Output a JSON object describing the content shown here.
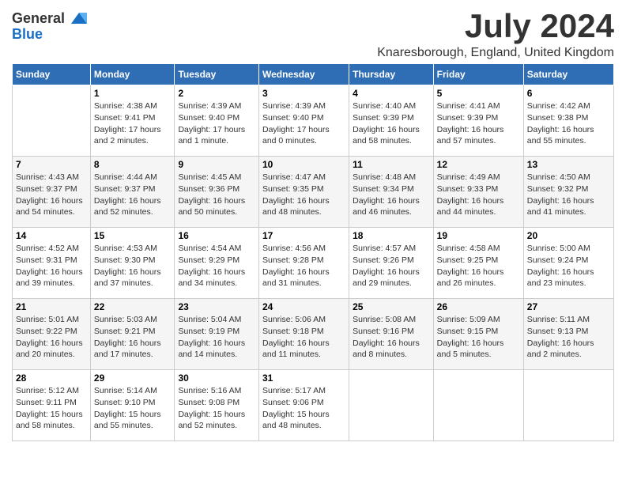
{
  "header": {
    "logo_general": "General",
    "logo_blue": "Blue",
    "month_title": "July 2024",
    "location": "Knaresborough, England, United Kingdom"
  },
  "columns": [
    "Sunday",
    "Monday",
    "Tuesday",
    "Wednesday",
    "Thursday",
    "Friday",
    "Saturday"
  ],
  "weeks": [
    [
      {
        "num": "",
        "info": ""
      },
      {
        "num": "1",
        "info": "Sunrise: 4:38 AM\nSunset: 9:41 PM\nDaylight: 17 hours\nand 2 minutes."
      },
      {
        "num": "2",
        "info": "Sunrise: 4:39 AM\nSunset: 9:40 PM\nDaylight: 17 hours\nand 1 minute."
      },
      {
        "num": "3",
        "info": "Sunrise: 4:39 AM\nSunset: 9:40 PM\nDaylight: 17 hours\nand 0 minutes."
      },
      {
        "num": "4",
        "info": "Sunrise: 4:40 AM\nSunset: 9:39 PM\nDaylight: 16 hours\nand 58 minutes."
      },
      {
        "num": "5",
        "info": "Sunrise: 4:41 AM\nSunset: 9:39 PM\nDaylight: 16 hours\nand 57 minutes."
      },
      {
        "num": "6",
        "info": "Sunrise: 4:42 AM\nSunset: 9:38 PM\nDaylight: 16 hours\nand 55 minutes."
      }
    ],
    [
      {
        "num": "7",
        "info": "Sunrise: 4:43 AM\nSunset: 9:37 PM\nDaylight: 16 hours\nand 54 minutes."
      },
      {
        "num": "8",
        "info": "Sunrise: 4:44 AM\nSunset: 9:37 PM\nDaylight: 16 hours\nand 52 minutes."
      },
      {
        "num": "9",
        "info": "Sunrise: 4:45 AM\nSunset: 9:36 PM\nDaylight: 16 hours\nand 50 minutes."
      },
      {
        "num": "10",
        "info": "Sunrise: 4:47 AM\nSunset: 9:35 PM\nDaylight: 16 hours\nand 48 minutes."
      },
      {
        "num": "11",
        "info": "Sunrise: 4:48 AM\nSunset: 9:34 PM\nDaylight: 16 hours\nand 46 minutes."
      },
      {
        "num": "12",
        "info": "Sunrise: 4:49 AM\nSunset: 9:33 PM\nDaylight: 16 hours\nand 44 minutes."
      },
      {
        "num": "13",
        "info": "Sunrise: 4:50 AM\nSunset: 9:32 PM\nDaylight: 16 hours\nand 41 minutes."
      }
    ],
    [
      {
        "num": "14",
        "info": "Sunrise: 4:52 AM\nSunset: 9:31 PM\nDaylight: 16 hours\nand 39 minutes."
      },
      {
        "num": "15",
        "info": "Sunrise: 4:53 AM\nSunset: 9:30 PM\nDaylight: 16 hours\nand 37 minutes."
      },
      {
        "num": "16",
        "info": "Sunrise: 4:54 AM\nSunset: 9:29 PM\nDaylight: 16 hours\nand 34 minutes."
      },
      {
        "num": "17",
        "info": "Sunrise: 4:56 AM\nSunset: 9:28 PM\nDaylight: 16 hours\nand 31 minutes."
      },
      {
        "num": "18",
        "info": "Sunrise: 4:57 AM\nSunset: 9:26 PM\nDaylight: 16 hours\nand 29 minutes."
      },
      {
        "num": "19",
        "info": "Sunrise: 4:58 AM\nSunset: 9:25 PM\nDaylight: 16 hours\nand 26 minutes."
      },
      {
        "num": "20",
        "info": "Sunrise: 5:00 AM\nSunset: 9:24 PM\nDaylight: 16 hours\nand 23 minutes."
      }
    ],
    [
      {
        "num": "21",
        "info": "Sunrise: 5:01 AM\nSunset: 9:22 PM\nDaylight: 16 hours\nand 20 minutes."
      },
      {
        "num": "22",
        "info": "Sunrise: 5:03 AM\nSunset: 9:21 PM\nDaylight: 16 hours\nand 17 minutes."
      },
      {
        "num": "23",
        "info": "Sunrise: 5:04 AM\nSunset: 9:19 PM\nDaylight: 16 hours\nand 14 minutes."
      },
      {
        "num": "24",
        "info": "Sunrise: 5:06 AM\nSunset: 9:18 PM\nDaylight: 16 hours\nand 11 minutes."
      },
      {
        "num": "25",
        "info": "Sunrise: 5:08 AM\nSunset: 9:16 PM\nDaylight: 16 hours\nand 8 minutes."
      },
      {
        "num": "26",
        "info": "Sunrise: 5:09 AM\nSunset: 9:15 PM\nDaylight: 16 hours\nand 5 minutes."
      },
      {
        "num": "27",
        "info": "Sunrise: 5:11 AM\nSunset: 9:13 PM\nDaylight: 16 hours\nand 2 minutes."
      }
    ],
    [
      {
        "num": "28",
        "info": "Sunrise: 5:12 AM\nSunset: 9:11 PM\nDaylight: 15 hours\nand 58 minutes."
      },
      {
        "num": "29",
        "info": "Sunrise: 5:14 AM\nSunset: 9:10 PM\nDaylight: 15 hours\nand 55 minutes."
      },
      {
        "num": "30",
        "info": "Sunrise: 5:16 AM\nSunset: 9:08 PM\nDaylight: 15 hours\nand 52 minutes."
      },
      {
        "num": "31",
        "info": "Sunrise: 5:17 AM\nSunset: 9:06 PM\nDaylight: 15 hours\nand 48 minutes."
      },
      {
        "num": "",
        "info": ""
      },
      {
        "num": "",
        "info": ""
      },
      {
        "num": "",
        "info": ""
      }
    ]
  ]
}
